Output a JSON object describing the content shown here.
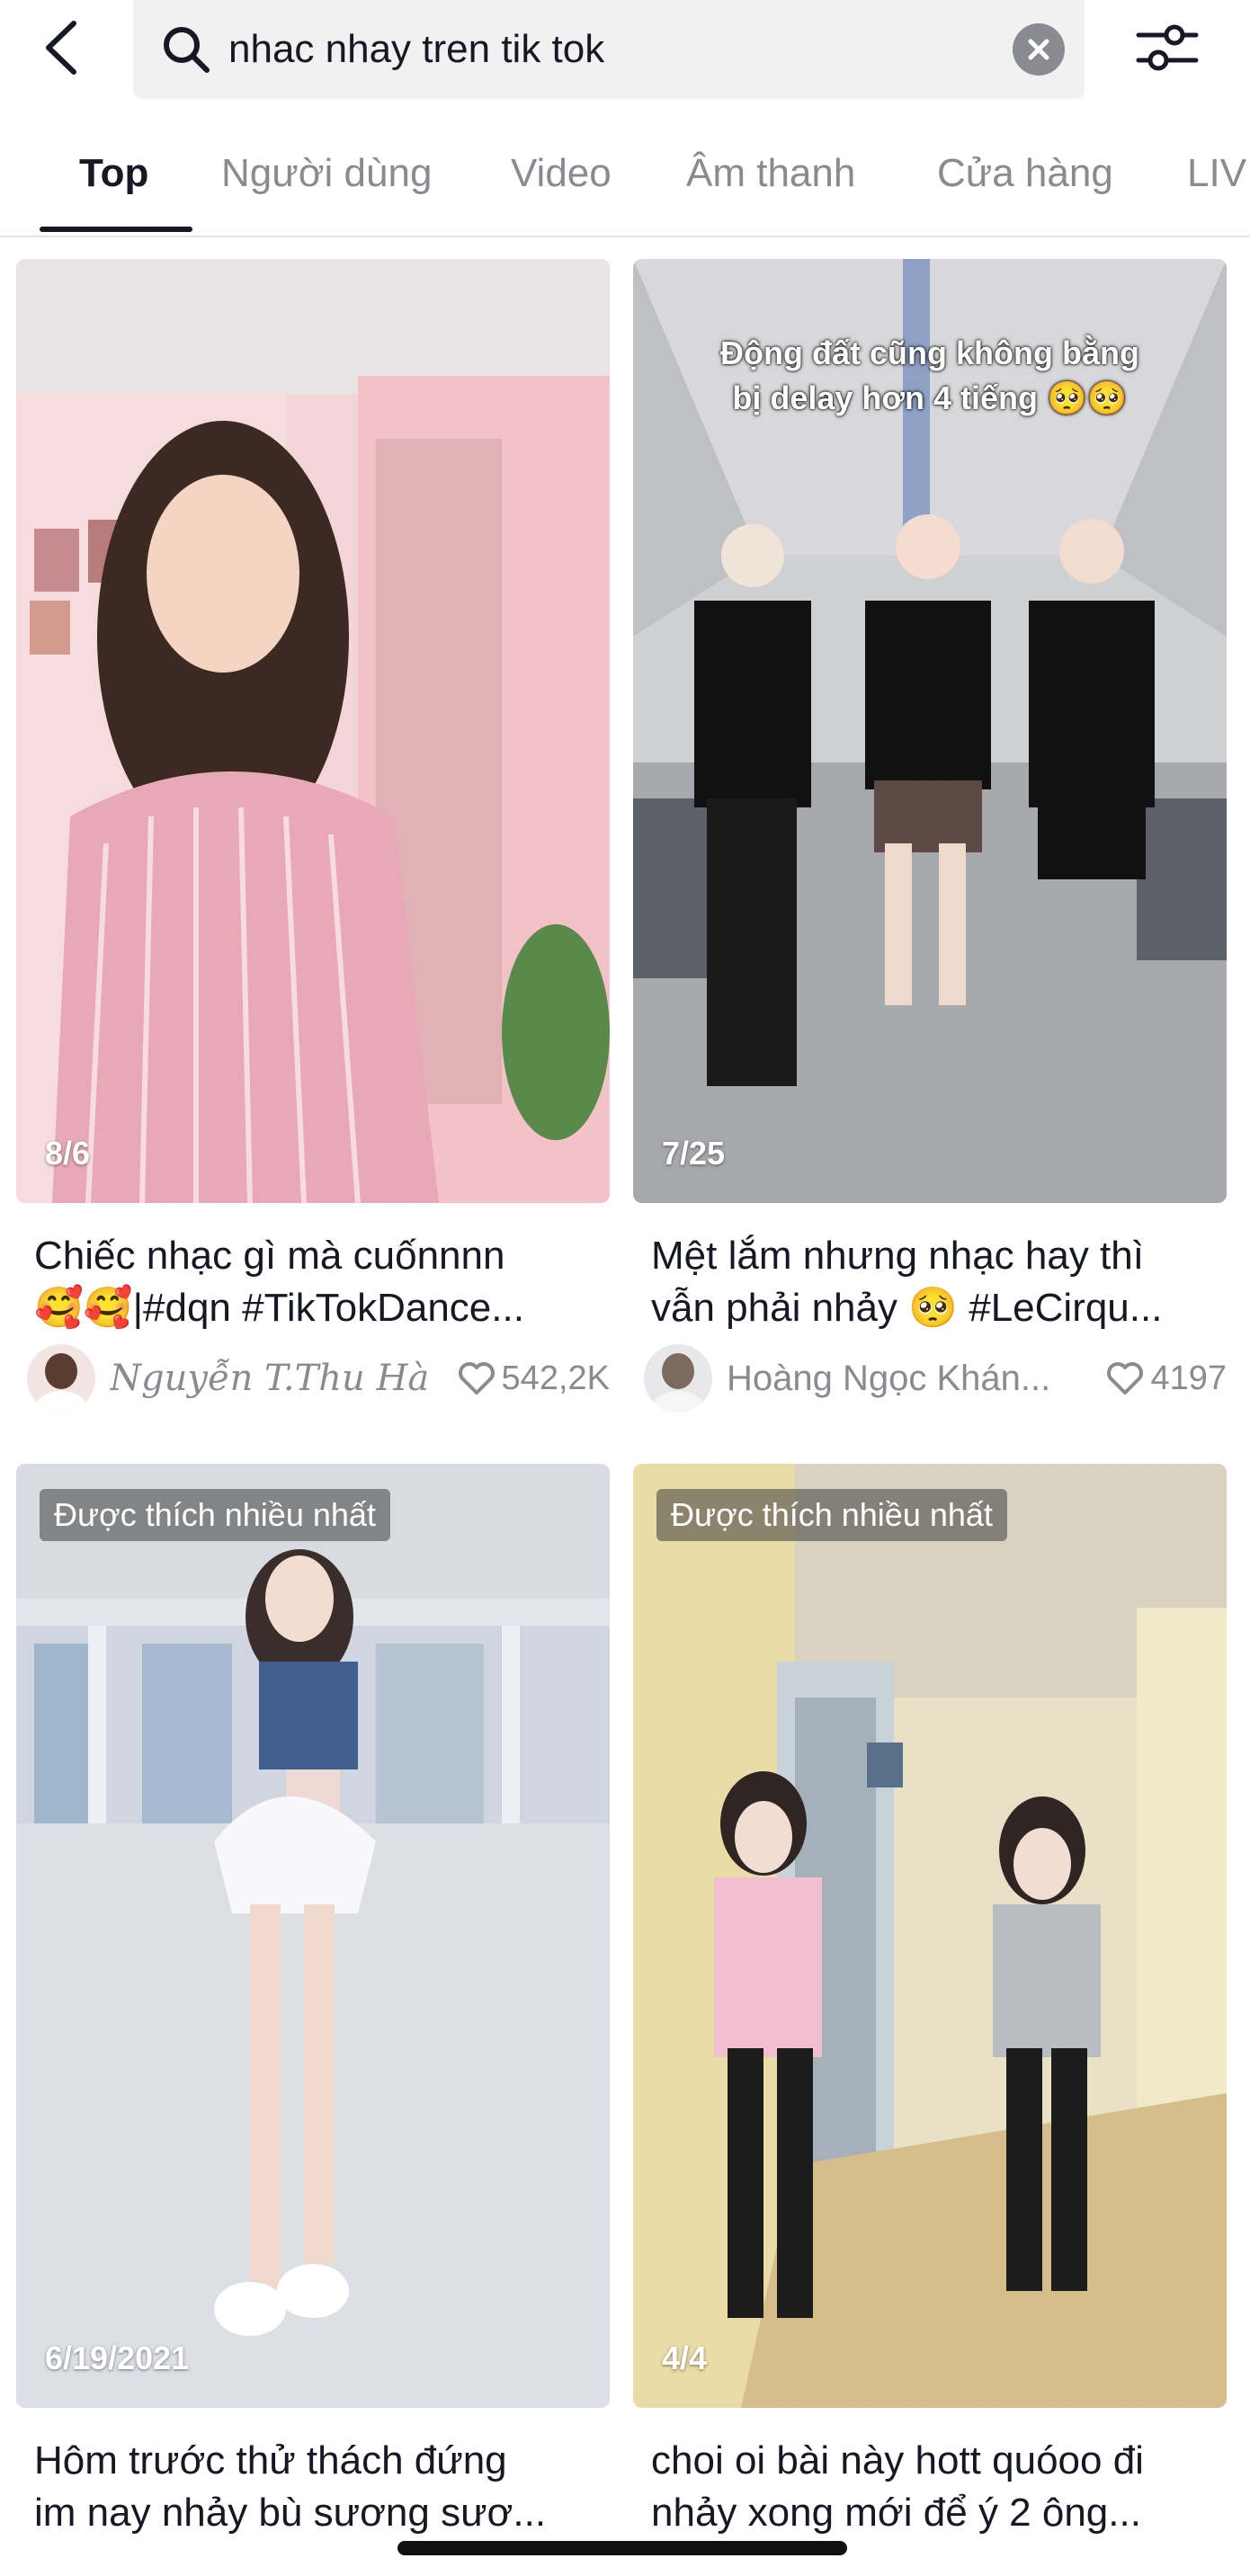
{
  "search": {
    "query": "nhac nhay tren tik tok",
    "back_icon": "chevron-left-icon",
    "search_icon": "search-icon",
    "clear_icon": "close-icon",
    "filter_icon": "sliders-icon"
  },
  "tabs": [
    {
      "label": "Top",
      "active": true
    },
    {
      "label": "Người dùng"
    },
    {
      "label": "Video"
    },
    {
      "label": "Âm thanh"
    },
    {
      "label": "Cửa hàng"
    },
    {
      "label": "LIV"
    }
  ],
  "videos": [
    {
      "date": "8/6",
      "caption_line1": "Chiếc nhạc gì mà cuốnnnn",
      "caption_line2": "🥰🥰|#dqn #TikTokDance...",
      "author": "Nguyễn T.Thu Hà",
      "likes": "542,2K"
    },
    {
      "date": "7/25",
      "overlay_text_line1": "Động đất cũng không bằng",
      "overlay_text_line2": "bị delay hơn 4 tiếng 🥺🥺",
      "caption_line1": "Mệt lắm nhưng nhạc hay thì",
      "caption_line2": "vẫn phải nhảy 🥺 #LeCirqu...",
      "author": "Hoàng Ngọc Khán...",
      "likes": "4197"
    },
    {
      "date": "6/19/2021",
      "badge": "Được thích nhiều nhất",
      "caption_line1": "Hôm trước thử thách đứng",
      "caption_line2": "im nay nhảy bù sương sươ..."
    },
    {
      "date": "4/4",
      "badge": "Được thích nhiều nhất",
      "caption_line1": "choi oi bài này hott quóoo đi",
      "caption_line2": "nhảy xong mới để ý 2 ông..."
    }
  ],
  "colors": {
    "text_primary": "#161823",
    "text_secondary": "#8a8b91",
    "search_bg": "#f1f1f2"
  }
}
